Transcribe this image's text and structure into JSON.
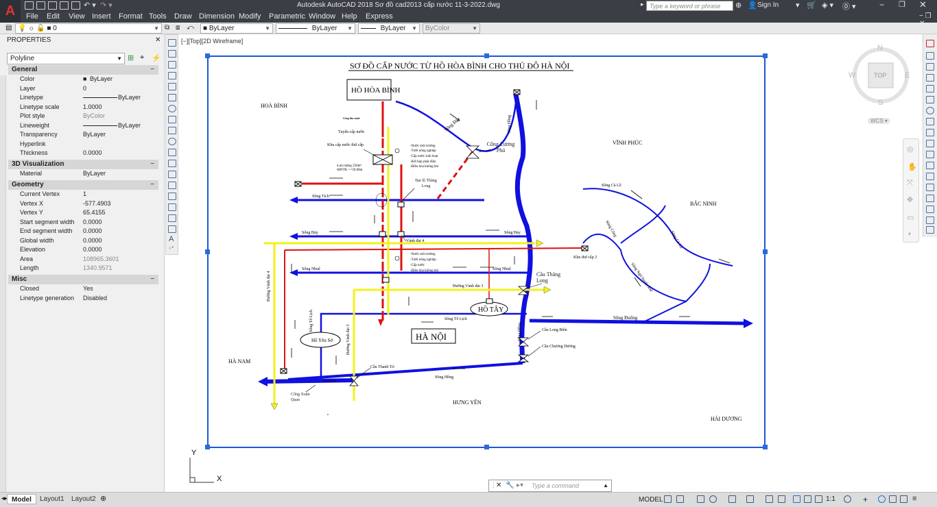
{
  "app": {
    "logo": "A",
    "title": "Autodesk AutoCAD 2018    Sơ đồ cad2013 cấp nước 11-3-2022.dwg",
    "search_placeholder": "Type a keyword or phrase",
    "sign_in": "Sign In"
  },
  "menu": [
    "File",
    "Edit",
    "View",
    "Insert",
    "Format",
    "Tools",
    "Draw",
    "Dimension",
    "Modify",
    "Parametric",
    "Window",
    "Help",
    "Express"
  ],
  "layerbar": {
    "layer": "0",
    "color": "ByLayer",
    "linetype": "ByLayer",
    "lineweight": "ByLayer",
    "plotstyle": "ByColor"
  },
  "properties": {
    "title": "PROPERTIES",
    "object_type": "Polyline",
    "sections": {
      "general": "General",
      "visual3d": "3D Visualization",
      "geometry": "Geometry",
      "misc": "Misc"
    },
    "general": [
      {
        "key": "Color",
        "value": "ByLayer"
      },
      {
        "key": "Layer",
        "value": "0"
      },
      {
        "key": "Linetype",
        "value": "ByLayer"
      },
      {
        "key": "Linetype scale",
        "value": "1.0000"
      },
      {
        "key": "Plot style",
        "value": "ByColor"
      },
      {
        "key": "Lineweight",
        "value": "ByLayer"
      },
      {
        "key": "Transparency",
        "value": "ByLayer"
      },
      {
        "key": "Hyperlink",
        "value": ""
      },
      {
        "key": "Thickness",
        "value": "0.0000"
      }
    ],
    "visual3d": [
      {
        "key": "Material",
        "value": "ByLayer"
      }
    ],
    "geometry": [
      {
        "key": "Current Vertex",
        "value": "1"
      },
      {
        "key": "Vertex X",
        "value": "-577.4903"
      },
      {
        "key": "Vertex Y",
        "value": "65.4155"
      },
      {
        "key": "Start segment width",
        "value": "0.0000"
      },
      {
        "key": "End segment width",
        "value": "0.0000"
      },
      {
        "key": "Global width",
        "value": "0.0000"
      },
      {
        "key": "Elevation",
        "value": "0.0000"
      },
      {
        "key": "Area",
        "value": "108965.3601"
      },
      {
        "key": "Length",
        "value": "1340.9571"
      }
    ],
    "misc": [
      {
        "key": "Closed",
        "value": "Yes"
      },
      {
        "key": "Linetype generation",
        "value": "Disabled"
      }
    ]
  },
  "viewport": {
    "label": "[−][Top][2D Wireframe]",
    "ucs_x": "X",
    "ucs_y": "Y"
  },
  "viewcube": {
    "n": "N",
    "s": "S",
    "e": "E",
    "w": "W",
    "face": "TOP",
    "wcs": "WCS"
  },
  "drawing": {
    "title": "SƠ ĐỒ CẤP NƯỚC TỪ HỒ HÒA BÌNH  CHO THỦ ĐÔ HÀ NỘI",
    "ho_hoa_binh": "HỒ HÒA BÌNH",
    "ha_noi": "HÀ NỘI",
    "ho_tay": "HỒ TÂY",
    "ho_yen_so": "Hồ Yên Sở",
    "hoa_binh": "HOÀ BÌNH",
    "vinh_phuc": "VĨNH PHÚC",
    "bac_ninh": "BẮC NINH",
    "ha_nam": "HÀ NAM",
    "hung_yen": "HƯNG YÊN",
    "hai_duong": "HẢI DƯƠNG",
    "song_da": "Sông Đà",
    "song_hong": "Sông Hồng",
    "song_tich": "Sông Tích",
    "song_day": "Sông Đáy",
    "song_nhue": "Sông Nhuệ",
    "song_to_lich": "Sông Tô Lịch",
    "song_to_lich_v": "Sông Tô Lịch",
    "song_ca_lo": "Sông Cà Lồ",
    "song_duong": "Sông Đuống",
    "song_ngu_huyen_khe": "Sông Ngũ huyện khê",
    "song_cong": "Sông Công",
    "song_ca_lo_2": "Sông Cà Lồ",
    "cong_luong_phu": "Cống Lương Phú",
    "cong_xuan_quan": "Cống Xuân Quan",
    "cau_thang_long": "Cầu Thăng Long",
    "cau_long_bien": "Cầu Long Biên",
    "cau_chuong_duong": "Cầu Chương Dương",
    "cau_thanh_tri": "Cầu Thanh Trì",
    "khu_thu_cap_1": "Khu cấp nước thứ cấp",
    "khu_thu_cap_2": "Khu thứ cấp 2",
    "tuyen_cap_nuoc": "Tuyến cấp nước",
    "cong_thu_nuoc": "Cống thu nước",
    "dai_lo": "Đại lộ Thăng Long",
    "vanh_dai_4": "Vành đai 4",
    "duong_vanh_dai_4": "Đường Vành đai 4",
    "duong_vanh_dai_3": "Đường Vành đai 3",
    "luu_luong": "-Lưu lượng 250m³",
    "mntk": "-MNTK >=50.00m",
    "uses_1": [
      "-Nước môi trường",
      "-Tưới nông nghiệp",
      "-Cấp nước sinh hoạt",
      "-Kết hợp phát điện",
      "-Điều hòa không khí"
    ],
    "uses_2": [
      "-Nước môi trường",
      "-Tưới nông nghiệp",
      "-Cấp nước",
      "-Điều hòa không khí"
    ]
  },
  "layouts": [
    "Model",
    "Layout1",
    "Layout2"
  ],
  "command": {
    "placeholder": "Type a command"
  },
  "status": {
    "model": "MODEL",
    "scale": "1:1"
  }
}
